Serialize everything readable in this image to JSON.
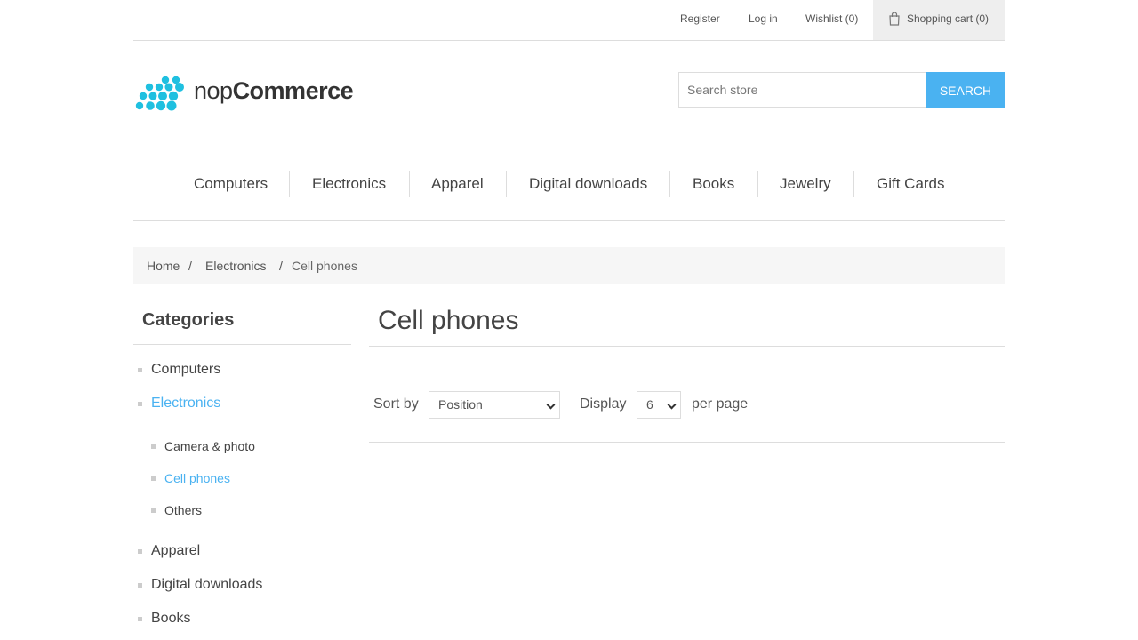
{
  "header_links": {
    "register": "Register",
    "login": "Log in",
    "wishlist": "Wishlist (0)",
    "cart": "Shopping cart (0)"
  },
  "logo": {
    "prefix": "nop",
    "suffix": "Commerce"
  },
  "search": {
    "placeholder": "Search store",
    "button": "SEARCH"
  },
  "menu": [
    "Computers",
    "Electronics",
    "Apparel",
    "Digital downloads",
    "Books",
    "Jewelry",
    "Gift Cards"
  ],
  "breadcrumb": {
    "home": "Home",
    "sep": "/",
    "level1": "Electronics",
    "current": "Cell phones"
  },
  "sidebar": {
    "title": "Categories",
    "items": [
      "Computers",
      "Electronics",
      "Apparel",
      "Digital downloads",
      "Books"
    ],
    "subitems": [
      "Camera & photo",
      "Cell phones",
      "Others"
    ]
  },
  "main": {
    "title": "Cell phones",
    "sort_label": "Sort by",
    "sort_value": "Position",
    "display_label": "Display",
    "page_size": "6",
    "per_page_label": "per page"
  },
  "colors": {
    "accent": "#4ab2f1",
    "logo": "#1fc0e0"
  }
}
